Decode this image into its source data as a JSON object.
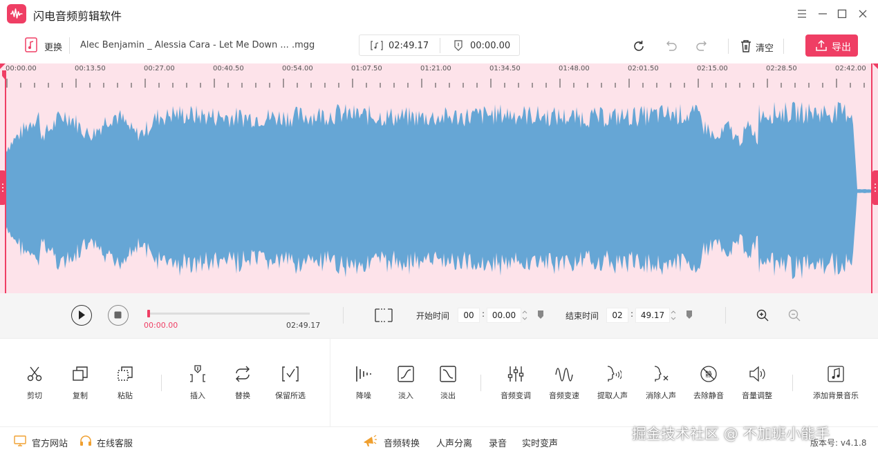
{
  "app": {
    "title": "闪电音频剪辑软件"
  },
  "toolbar": {
    "replace_label": "更换",
    "file_name": "Alec Benjamin _ Alessia Cara - Let Me Down ... .mgg",
    "duration": "02:49.17",
    "position": "00:00.00",
    "clear_label": "清空",
    "export_label": "导出"
  },
  "ruler": {
    "labels": [
      "00:00.00",
      "00:13.50",
      "00:27.00",
      "00:40.50",
      "00:54.00",
      "01:07.50",
      "01:21.00",
      "01:34.50",
      "01:48.00",
      "02:01.50",
      "02:15.00",
      "02:28.50",
      "02:42.00"
    ]
  },
  "transport": {
    "current_time": "00:00.00",
    "total_time": "02:49.17",
    "progress": 0,
    "start_label": "开始时间",
    "start_min": "00",
    "start_sec": "00.00",
    "end_label": "结束时间",
    "end_min": "02",
    "end_sec": "49.17"
  },
  "tools": {
    "cut": "剪切",
    "copy": "复制",
    "paste": "粘贴",
    "insert": "插入",
    "replace": "替换",
    "keep_selection": "保留所选",
    "denoise": "降噪",
    "fade_in": "淡入",
    "fade_out": "淡出",
    "pitch": "音频变调",
    "speed": "音频变速",
    "extract_vocal": "提取人声",
    "remove_vocal": "消除人声",
    "remove_silence": "去除静音",
    "volume": "音量调整",
    "add_bgm": "添加背景音乐",
    "silence_glyph": "静"
  },
  "status": {
    "website": "官方网站",
    "support": "在线客服",
    "convert": "音频转换",
    "vocal_split": "人声分离",
    "record": "录音",
    "realtime_voice": "实时变声",
    "watermark": "掘金技术社区 @ 不加班小能手",
    "version": "版本号: v4.1.8"
  },
  "colors": {
    "accent": "#ef3e64",
    "wave": "#66a6d5",
    "wave_bg": "#fde3ea"
  }
}
